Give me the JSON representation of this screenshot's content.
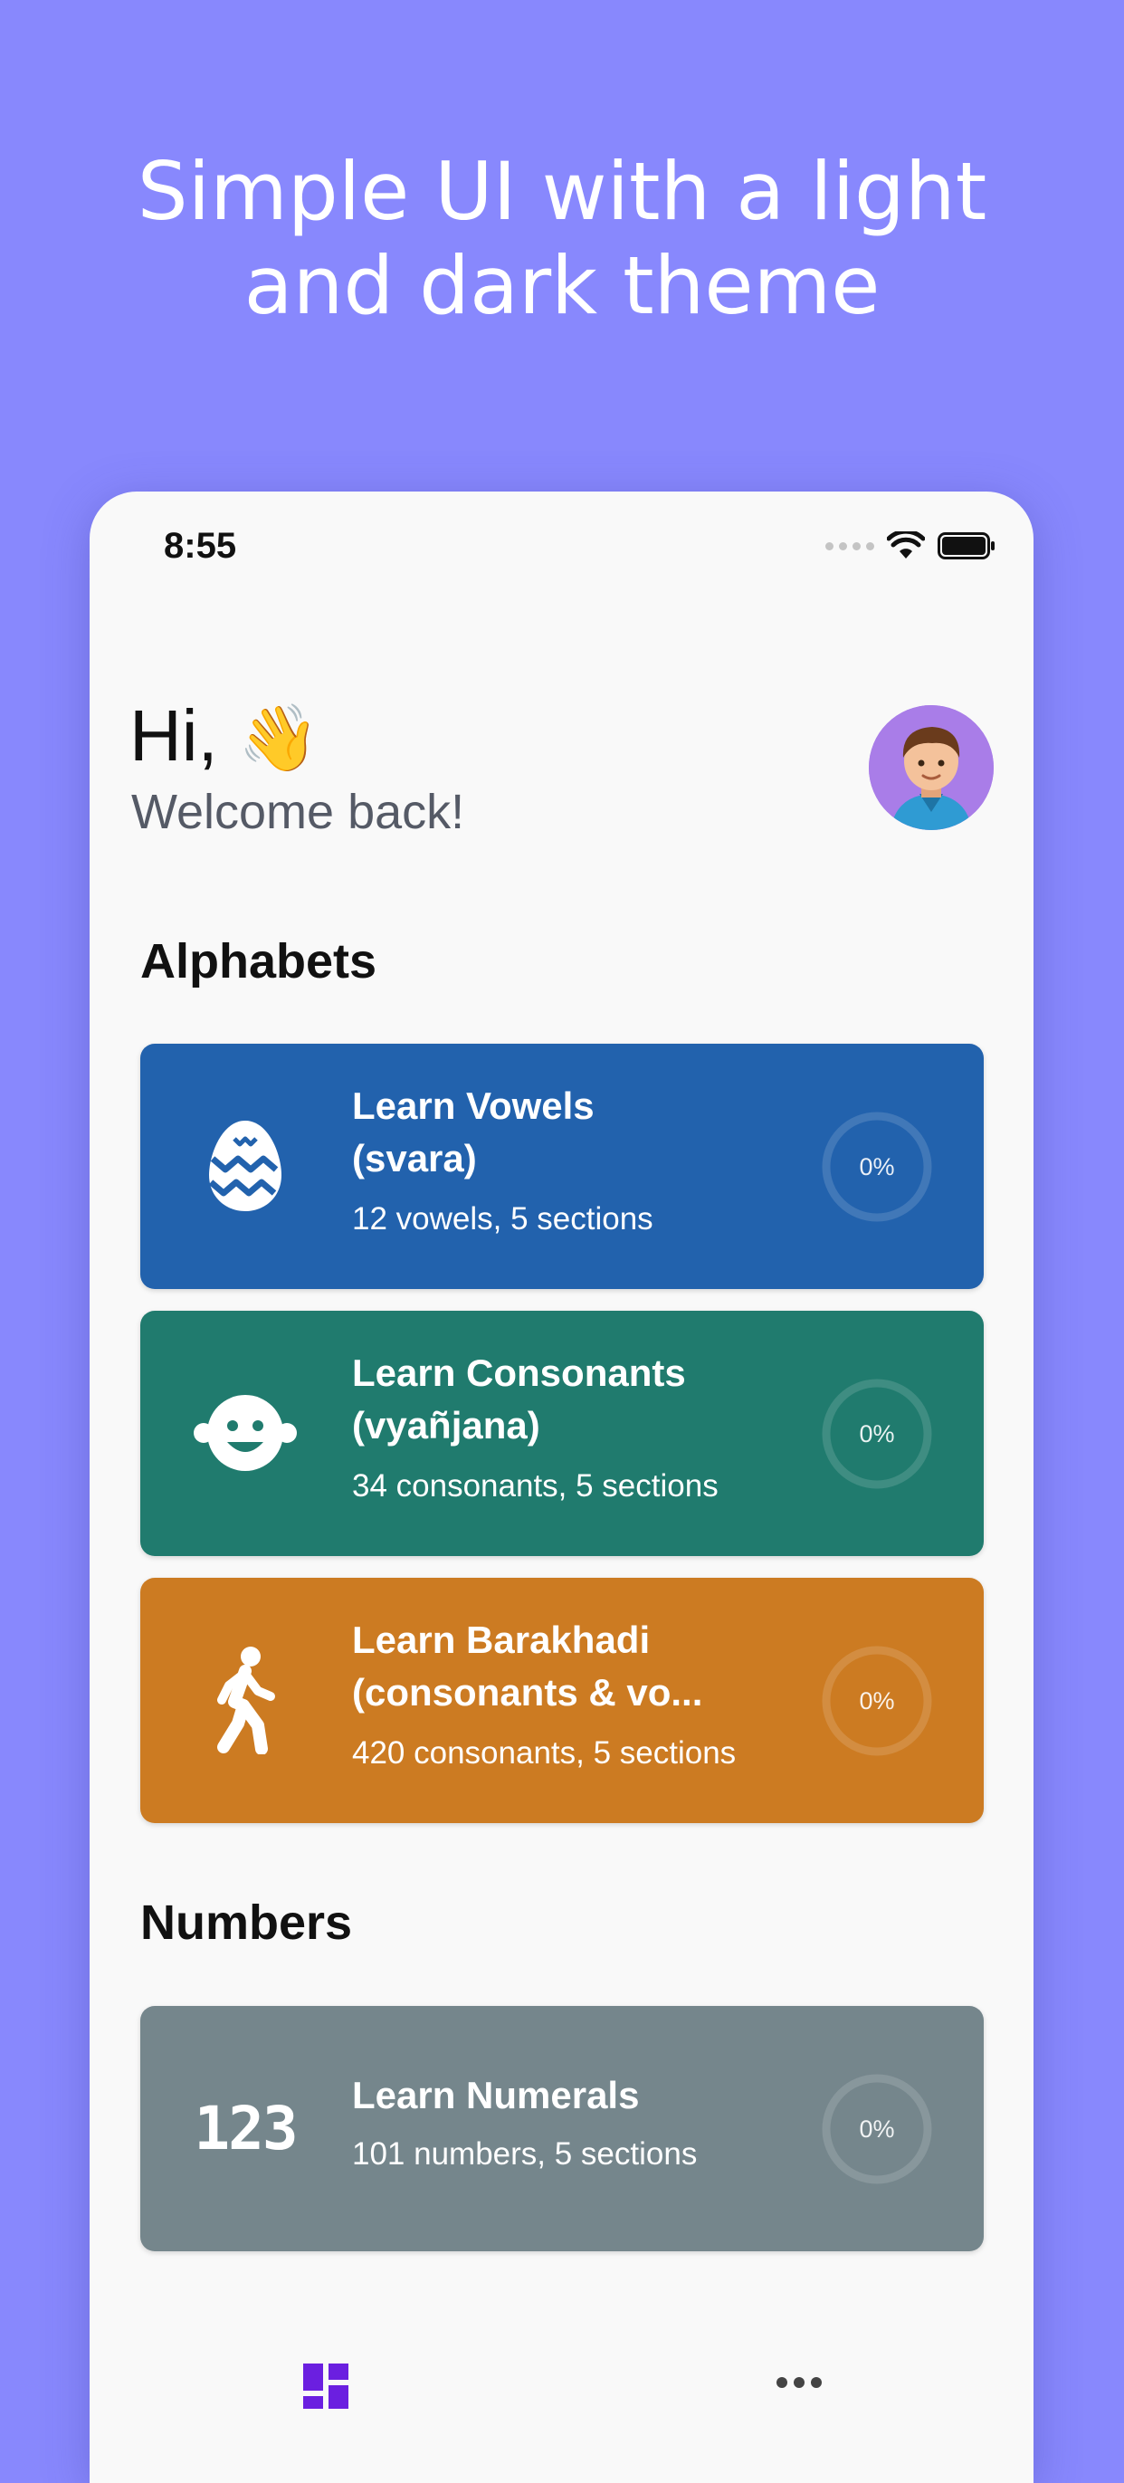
{
  "headline": {
    "line1": "Simple UI with a light",
    "line2": "and dark theme"
  },
  "status_bar": {
    "time": "8:55"
  },
  "greeting": {
    "hi": "Hi,",
    "wave": "👋",
    "welcome": "Welcome back!"
  },
  "sections": {
    "alphabets": "Alphabets",
    "numbers": "Numbers"
  },
  "cards": [
    {
      "title_line1": "Learn Vowels",
      "title_line2": "(svara)",
      "subtitle": "12 vowels, 5 sections",
      "progress_label": "0%",
      "progress": 0,
      "color": "#2262ad",
      "icon": "easter-egg-icon"
    },
    {
      "title_line1": "Learn Consonants",
      "title_line2": "(vyañjana)",
      "subtitle": "34 consonants, 5 sections",
      "progress_label": "0%",
      "progress": 0,
      "color": "#207b6e",
      "icon": "baby-face-icon"
    },
    {
      "title_line1": "Learn Barakhadi",
      "title_line2": "(consonants & vo...",
      "subtitle": "420 consonants, 5 sections",
      "progress_label": "0%",
      "progress": 0,
      "color": "#cc7b22",
      "icon": "walking-person-icon"
    },
    {
      "title_line1": "Learn Numerals",
      "subtitle": "101 numbers, 5 sections",
      "progress_label": "0%",
      "progress": 0,
      "color": "#75868c",
      "icon": "numerals-icon",
      "icon_text": "123"
    }
  ],
  "tabbar": {
    "left_icon": "dashboard-icon",
    "right_icon": "more-icon",
    "accent": "#6b1fe0"
  }
}
